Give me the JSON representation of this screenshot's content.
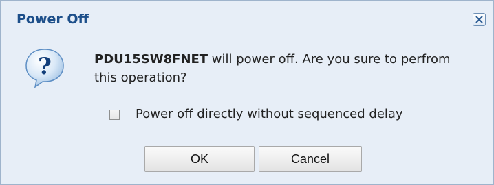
{
  "dialog": {
    "title": "Power Off",
    "close_icon": "close-x-icon",
    "question_icon": "question-bubble-icon",
    "message": {
      "device_name": "PDU15SW8FNET",
      "text": " will power off. Are you sure to perfrom this operation?"
    },
    "checkbox": {
      "label": "Power off directly without sequenced delay",
      "checked": false
    },
    "buttons": {
      "ok": "OK",
      "cancel": "Cancel"
    }
  },
  "colors": {
    "title": "#1d4f8a",
    "dialog_background": "#e7eef7",
    "border": "#9fb4cc",
    "icon_blue": "#2a6fb6"
  }
}
